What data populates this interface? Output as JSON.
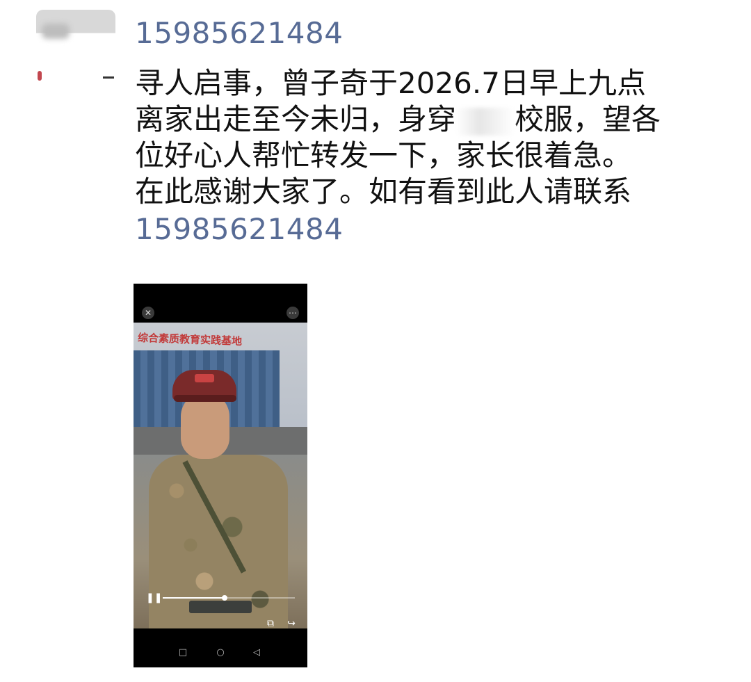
{
  "sender": {
    "avatar": "avatar-blurred"
  },
  "message": {
    "phone_top": "15985621484",
    "lines": [
      "寻人启事，曾子奇于2026.7日早上九点",
      "离家出走至今未归，身穿",
      "校服，望各",
      "位好心人帮忙转发一下，家长很着急。",
      "在此感谢大家了。如有看到此人请联系"
    ],
    "phone_bottom": "15985621484"
  },
  "video": {
    "sign_text": "综合素质教育实践基地",
    "progress": 0.47,
    "icons": {
      "close": "close-icon",
      "more": "more-icon",
      "pause": "pause-icon",
      "save": "save-icon",
      "share": "share-icon",
      "nav_back": "back-icon",
      "nav_home": "home-icon",
      "nav_recent": "recent-icon"
    }
  },
  "colors": {
    "link": "#576b95",
    "text": "#111111",
    "background": "#ffffff"
  }
}
